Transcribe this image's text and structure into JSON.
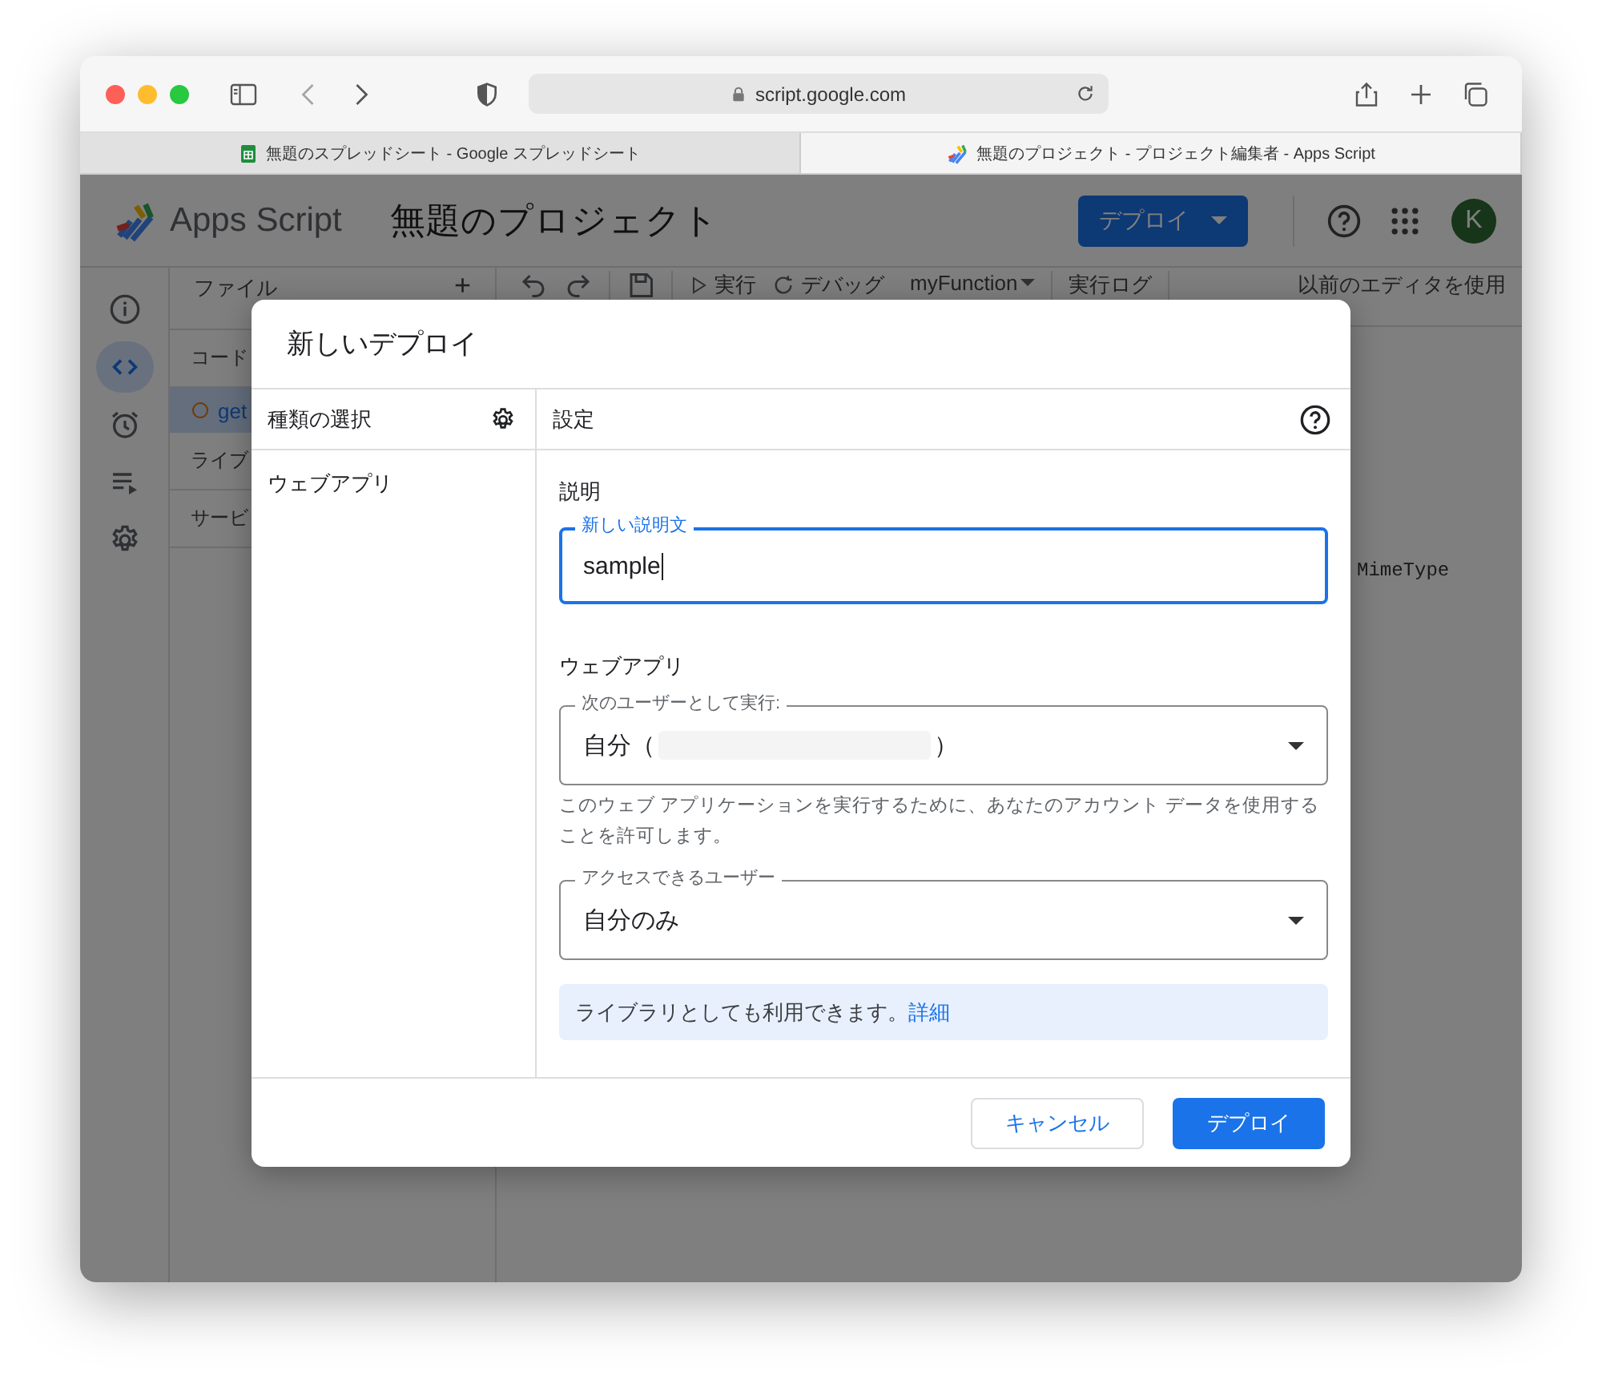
{
  "browser": {
    "url": "script.google.com",
    "tabs": [
      {
        "title": "無題のスプレッドシート - Google スプレッドシート",
        "selected": false,
        "kind": "sheets"
      },
      {
        "title": "無題のプロジェクト - プロジェクト編集者 - Apps Script",
        "selected": true,
        "kind": "apps-script"
      }
    ]
  },
  "app": {
    "product": "Apps Script",
    "project_title": "無題のプロジェクト",
    "deploy_button": "デプロイ",
    "avatar": "K",
    "rail": [
      {
        "kind": "info",
        "selected": false
      },
      {
        "kind": "code",
        "selected": true
      },
      {
        "kind": "alarm",
        "selected": false
      },
      {
        "kind": "executions",
        "selected": false
      },
      {
        "kind": "settings",
        "selected": false
      }
    ],
    "files": {
      "title": "ファイル",
      "add": "+",
      "rows": [
        {
          "kind": "section",
          "label": "コード"
        },
        {
          "kind": "file",
          "label": "get",
          "selected": true
        },
        {
          "kind": "section",
          "label": "ライブ"
        },
        {
          "kind": "section",
          "label": "サービ"
        }
      ]
    },
    "toolbar": {
      "run": "実行",
      "debug": "デバッグ",
      "function": "myFunction",
      "log": "実行ログ",
      "legacy": "以前のエディタを使用"
    },
    "editor": {
      "code_fragment": "MimeType"
    }
  },
  "dialog": {
    "title": "新しいデプロイ",
    "types_header": "種類の選択",
    "types": [
      "ウェブアプリ"
    ],
    "settings_header": "設定",
    "description": {
      "heading": "説明",
      "label": "新しい説明文",
      "value": "sample",
      "focused": true
    },
    "web_app": {
      "heading": "ウェブアプリ",
      "execute_as": {
        "label": "次のユーザーとして実行:",
        "value_prefix": "自分（",
        "value_suffix": "）"
      },
      "help": "このウェブ アプリケーションを実行するために、あなたのアカウント データを使用することを許可します。",
      "access": {
        "label": "アクセスできるユーザー",
        "value": "自分のみ"
      }
    },
    "info": {
      "text": "ライブラリとしても利用できます。",
      "link": "詳細"
    },
    "buttons": {
      "cancel": "キャンセル",
      "deploy": "デプロイ"
    }
  }
}
